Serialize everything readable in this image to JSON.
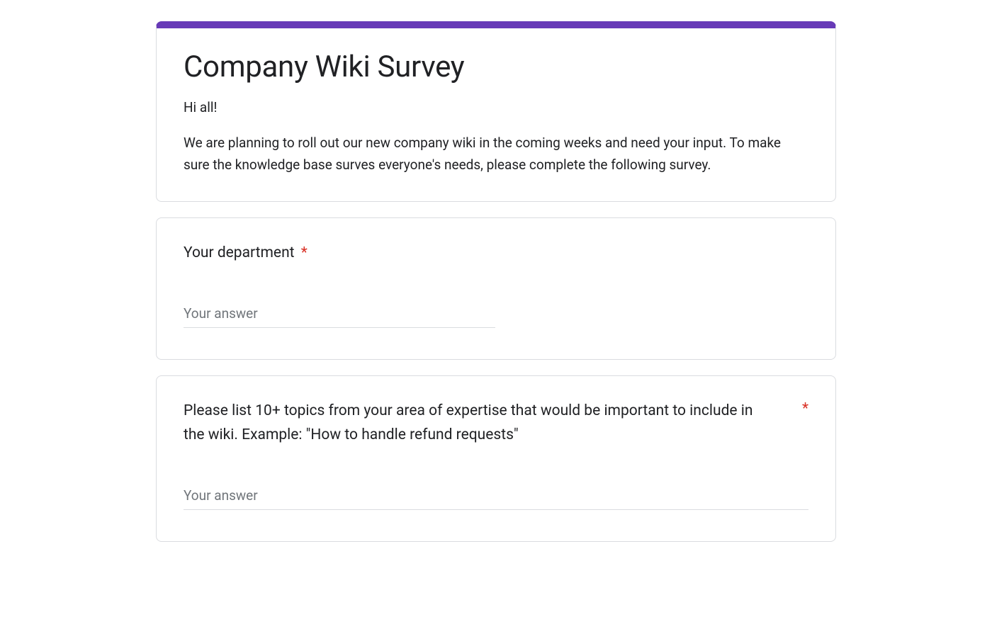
{
  "form": {
    "title": "Company Wiki Survey",
    "description_greeting": "Hi all!",
    "description_body": "We are planning to roll out our new company wiki in the coming weeks and need your input. To make sure the knowledge base surves everyone's needs, please complete the following survey."
  },
  "questions": [
    {
      "label": "Your department",
      "required_marker": "*",
      "placeholder": "Your answer"
    },
    {
      "label": "Please list 10+ topics from your area of expertise that would be important to include in the wiki. Example: \"How to handle refund requests\"",
      "required_marker": "*",
      "placeholder": "Your answer"
    }
  ],
  "colors": {
    "accent": "#673ab7",
    "required": "#d93025"
  }
}
